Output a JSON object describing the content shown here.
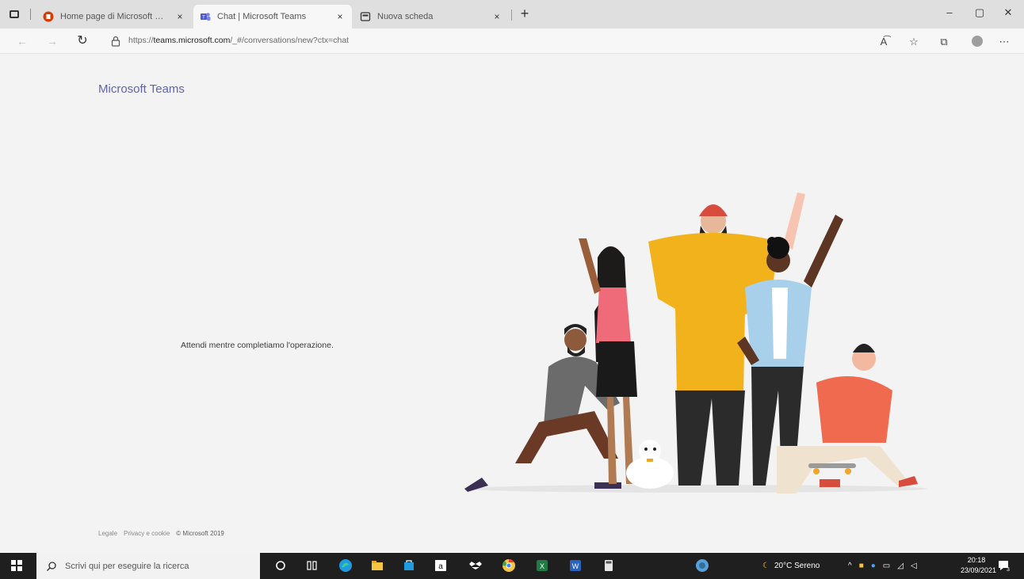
{
  "browser": {
    "tabs": [
      {
        "title": "Home page di Microsoft Office",
        "close": "×"
      },
      {
        "title": "Chat | Microsoft Teams",
        "close": "×"
      },
      {
        "title": "Nuova scheda",
        "close": "×"
      }
    ],
    "new_tab": "+",
    "window_controls": {
      "minimize": "–",
      "maximize": "▢",
      "close": "✕"
    },
    "address": {
      "prefix": "https://",
      "host": "teams.microsoft.com",
      "path": "/_#/conversations/new?ctx=chat"
    },
    "toolbar_icons": [
      "read-aloud-icon",
      "favorites-icon",
      "collections-icon",
      "profile-icon",
      "more-icon"
    ]
  },
  "page": {
    "brand": "Microsoft Teams",
    "status_message": "Attendi mentre completiamo l'operazione.",
    "footer": {
      "legal": "Legale",
      "privacy": "Privacy e cookie",
      "copyright": "© Microsoft 2019"
    }
  },
  "taskbar": {
    "search_placeholder": "Scrivi qui per eseguire la ricerca",
    "weather": "20°C Sereno",
    "time": "20:18",
    "date": "23/09/2021",
    "notification_count": "3"
  },
  "colors": {
    "teams_brand": "#6264a7",
    "page_background": "#f3f3f3",
    "taskbar": "#1f1f1f"
  }
}
